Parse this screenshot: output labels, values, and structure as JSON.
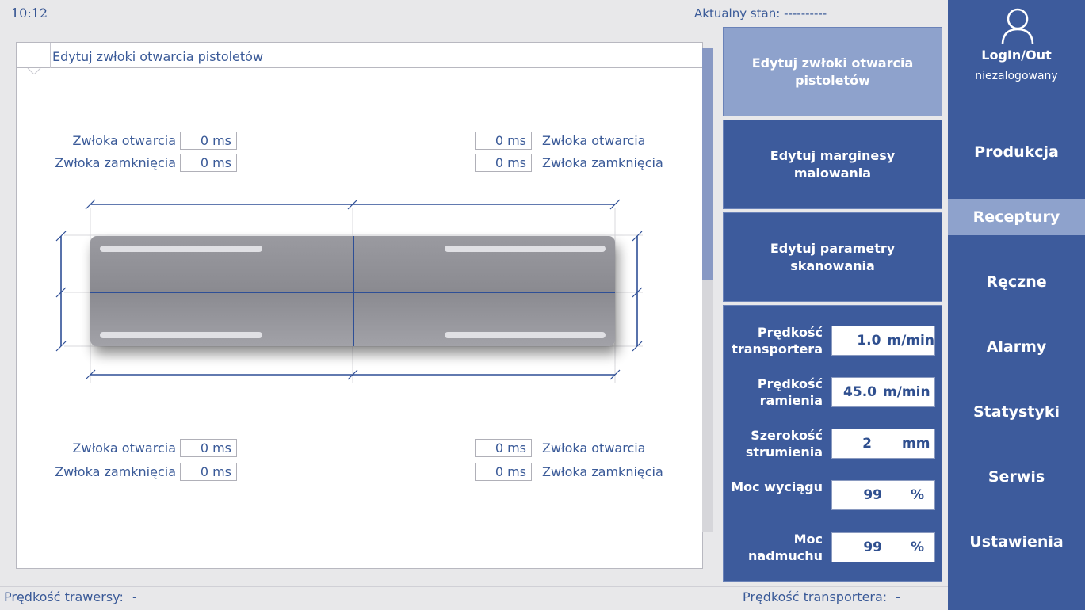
{
  "header": {
    "time": "10:12",
    "status_label": "Aktualny stan:",
    "status_value": "----------"
  },
  "panel": {
    "title": "Edytuj zwłoki otwarcia pistoletów",
    "top_left": {
      "open_label": "Zwłoka otwarcia",
      "open_value": "0 ms",
      "close_label": "Zwłoka zamknięcia",
      "close_value": "0 ms"
    },
    "top_right": {
      "open_label": "Zwłoka otwarcia",
      "open_value": "0 ms",
      "close_label": "Zwłoka zamknięcia",
      "close_value": "0 ms"
    },
    "bottom_left": {
      "open_label": "Zwłoka otwarcia",
      "open_value": "0 ms",
      "close_label": "Zwłoka zamknięcia",
      "close_value": "0 ms"
    },
    "bottom_right": {
      "open_label": "Zwłoka otwarcia",
      "open_value": "0 ms",
      "close_label": "Zwłoka zamknięcia",
      "close_value": "0 ms"
    }
  },
  "actions": {
    "edit_gun_delays": "Edytuj zwłoki otwarcia pistoletów",
    "edit_margins": "Edytuj marginesy malowania",
    "edit_scan_params": "Edytuj parametry skanowania"
  },
  "params": [
    {
      "label": "Prędkość transportera",
      "value": "1.0",
      "unit": "m/min"
    },
    {
      "label": "Prędkość ramienia",
      "value": "45.0",
      "unit": "m/min"
    },
    {
      "label": "Szerokość strumienia",
      "value": "2",
      "unit": "mm"
    },
    {
      "label": "Moc wyciągu",
      "value": "99",
      "unit": "%"
    },
    {
      "label": "Moc nadmuchu",
      "value": "99",
      "unit": "%"
    }
  ],
  "sidebar": {
    "login_label": "LogIn/Out",
    "login_status": "niezalogowany",
    "items": [
      "Produkcja",
      "Receptury",
      "Ręczne",
      "Alarmy",
      "Statystyki",
      "Serwis",
      "Ustawienia"
    ],
    "active": "Receptury"
  },
  "footer": {
    "traverse_speed_label": "Prędkość trawersy:",
    "traverse_speed_value": "-",
    "conveyor_speed_label": "Prędkość transportera:",
    "conveyor_speed_value": "-"
  },
  "colors": {
    "accent": "#3d5b9c",
    "active": "#8ea2cc",
    "text": "#3a5a98"
  }
}
